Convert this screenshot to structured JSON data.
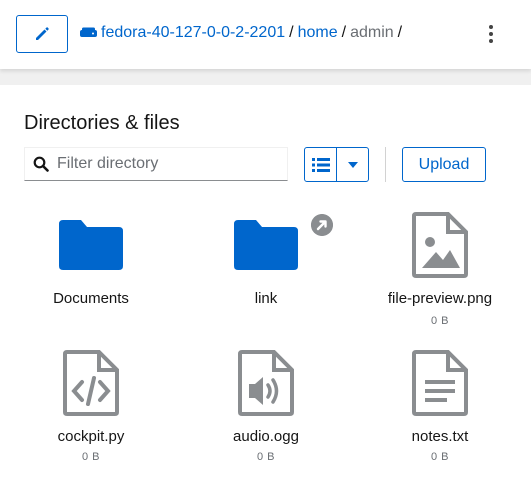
{
  "toolbar": {
    "host": "fedora-40-127-0-0-2-2201",
    "breadcrumb": [
      "home",
      "admin"
    ],
    "separator": "/"
  },
  "section": {
    "title": "Directories & files"
  },
  "filter": {
    "placeholder": "Filter directory",
    "value": ""
  },
  "actions": {
    "upload_label": "Upload"
  },
  "files": [
    {
      "name": "Documents",
      "type": "folder",
      "size": ""
    },
    {
      "name": "link",
      "type": "folder-symlink",
      "size": ""
    },
    {
      "name": "file-preview.png",
      "type": "image",
      "size": "0 B"
    },
    {
      "name": "cockpit.py",
      "type": "code",
      "size": "0 B"
    },
    {
      "name": "audio.ogg",
      "type": "audio",
      "size": "0 B"
    },
    {
      "name": "notes.txt",
      "type": "text",
      "size": "0 B"
    }
  ],
  "icons": {
    "edit": "pencil-icon",
    "host": "server-icon",
    "menu": "kebab-icon",
    "search": "search-icon",
    "view": "list-view-icon",
    "dropdown": "caret-down-icon",
    "symlink": "symlink-arrow-icon"
  },
  "colors": {
    "accent": "#0066cc",
    "folder": "#0066cc",
    "file_icon": "#8a8d90",
    "text": "#151515",
    "muted": "#6a6e73"
  }
}
